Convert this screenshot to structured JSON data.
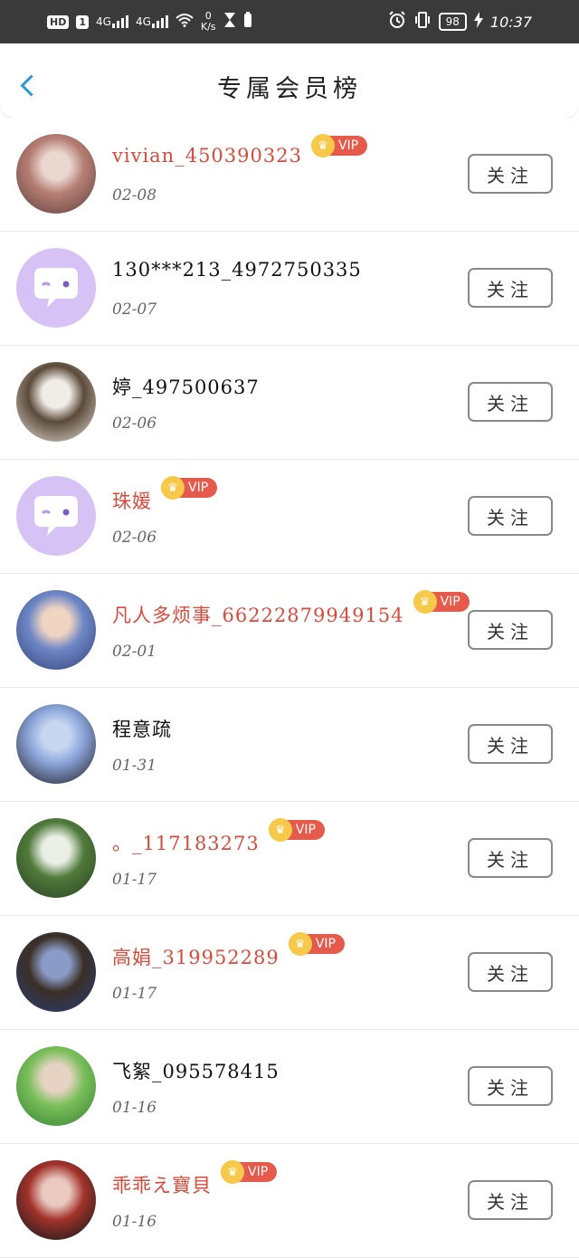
{
  "statusbar": {
    "hd": "HD",
    "sim": "1",
    "sig1": "4G",
    "sig2": "4G",
    "net_speed": "0",
    "net_unit": "K/s",
    "battery": "98",
    "time": "10:37"
  },
  "header": {
    "title": "专属会员榜"
  },
  "follow_label": "关注",
  "vip_label": "VIP",
  "members": [
    {
      "name": "vivian_450390323",
      "date": "02-08",
      "vip": true,
      "avatar": "photo",
      "colors": [
        "#6b4a44",
        "#e9d7d0",
        "#b57e74"
      ]
    },
    {
      "name": "130***213_4972750335",
      "date": "02-07",
      "vip": false,
      "avatar": "default"
    },
    {
      "name": "婷_497500637",
      "date": "02-06",
      "vip": false,
      "avatar": "photo",
      "colors": [
        "#cfc6bd",
        "#f0ece6",
        "#5b4a3a"
      ]
    },
    {
      "name": "珠媛",
      "date": "02-06",
      "vip": true,
      "avatar": "default"
    },
    {
      "name": "凡人多烦事_66222879949154",
      "date": "02-01",
      "vip": true,
      "avatar": "photo",
      "colors": [
        "#3c4f86",
        "#f0d4c2",
        "#6d86c5"
      ]
    },
    {
      "name": "程意疏",
      "date": "01-31",
      "vip": false,
      "avatar": "photo",
      "colors": [
        "#2e2f3c",
        "#c7d6f0",
        "#8aa4d8"
      ]
    },
    {
      "name": "。_117183273",
      "date": "01-17",
      "vip": true,
      "avatar": "photo",
      "colors": [
        "#2f4a25",
        "#e9efe4",
        "#507a3a"
      ]
    },
    {
      "name": "高娟_319952289",
      "date": "01-17",
      "vip": true,
      "avatar": "photo",
      "colors": [
        "#2a3a6e",
        "#8a9bc8",
        "#3b2f25"
      ]
    },
    {
      "name": "飞絮_095578415",
      "date": "01-16",
      "vip": false,
      "avatar": "photo",
      "colors": [
        "#3f8a3a",
        "#e7d3c4",
        "#7bbf5a"
      ]
    },
    {
      "name": "乖乖え寶貝",
      "date": "01-16",
      "vip": true,
      "avatar": "photo",
      "colors": [
        "#1d1d1d",
        "#e9c9c0",
        "#a2322a"
      ]
    }
  ]
}
